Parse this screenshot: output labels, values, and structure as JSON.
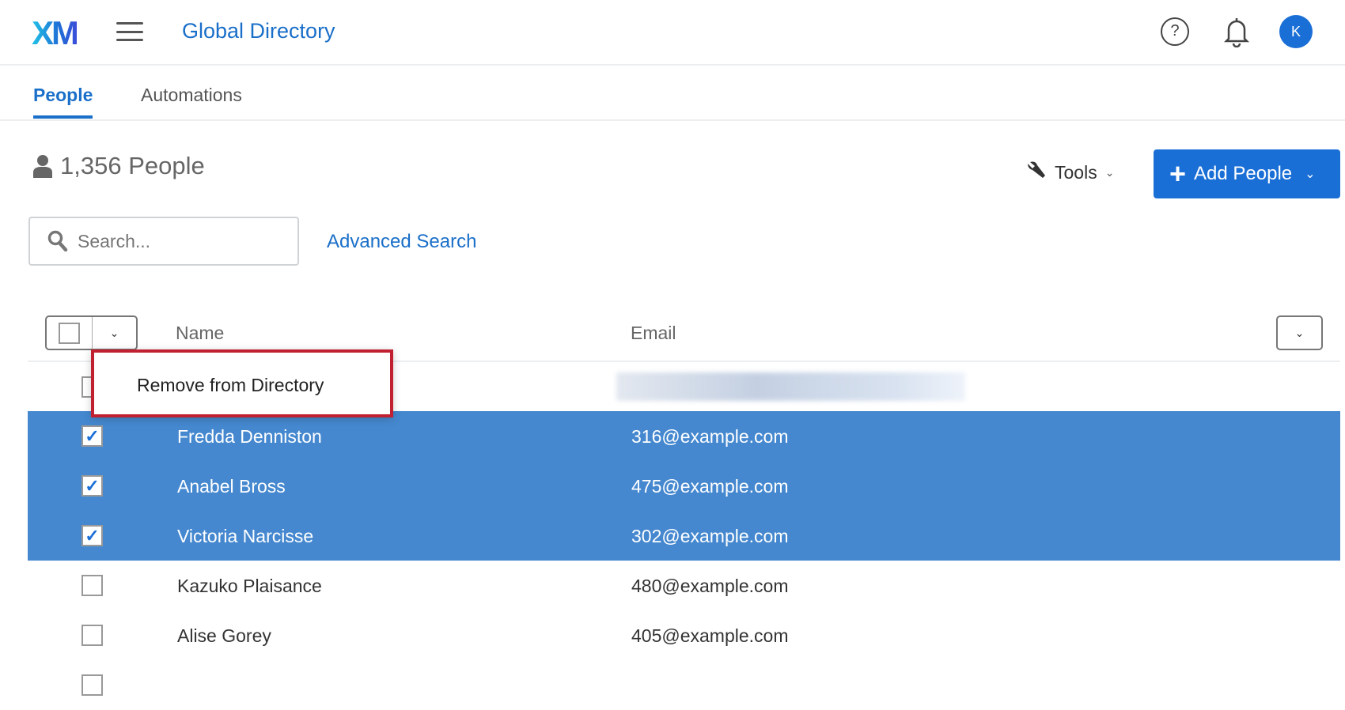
{
  "header": {
    "logo": "XM",
    "title": "Global Directory",
    "help_icon": "?",
    "avatar_initial": "K"
  },
  "tabs": [
    {
      "label": "People",
      "active": true
    },
    {
      "label": "Automations",
      "active": false
    }
  ],
  "summary": {
    "count_label": "1,356 People"
  },
  "toolbar": {
    "tools_label": "Tools",
    "add_label": "Add People"
  },
  "search": {
    "placeholder": "Search...",
    "advanced_label": "Advanced Search"
  },
  "table": {
    "columns": [
      "Name",
      "Email"
    ],
    "rows": [
      {
        "name": "",
        "email": "",
        "checked": false,
        "blurred": true
      },
      {
        "name": "Fredda Denniston",
        "email": "316@example.com",
        "checked": true
      },
      {
        "name": "Anabel Bross",
        "email": "475@example.com",
        "checked": true
      },
      {
        "name": "Victoria Narcisse",
        "email": "302@example.com",
        "checked": true
      },
      {
        "name": "Kazuko Plaisance",
        "email": "480@example.com",
        "checked": false
      },
      {
        "name": "Alise Gorey",
        "email": "405@example.com",
        "checked": false
      }
    ]
  },
  "popup": {
    "item": "Remove from Directory"
  },
  "colors": {
    "accent": "#1a6fd6",
    "selected_row": "#4588cf",
    "highlight_border": "#c0202f"
  }
}
